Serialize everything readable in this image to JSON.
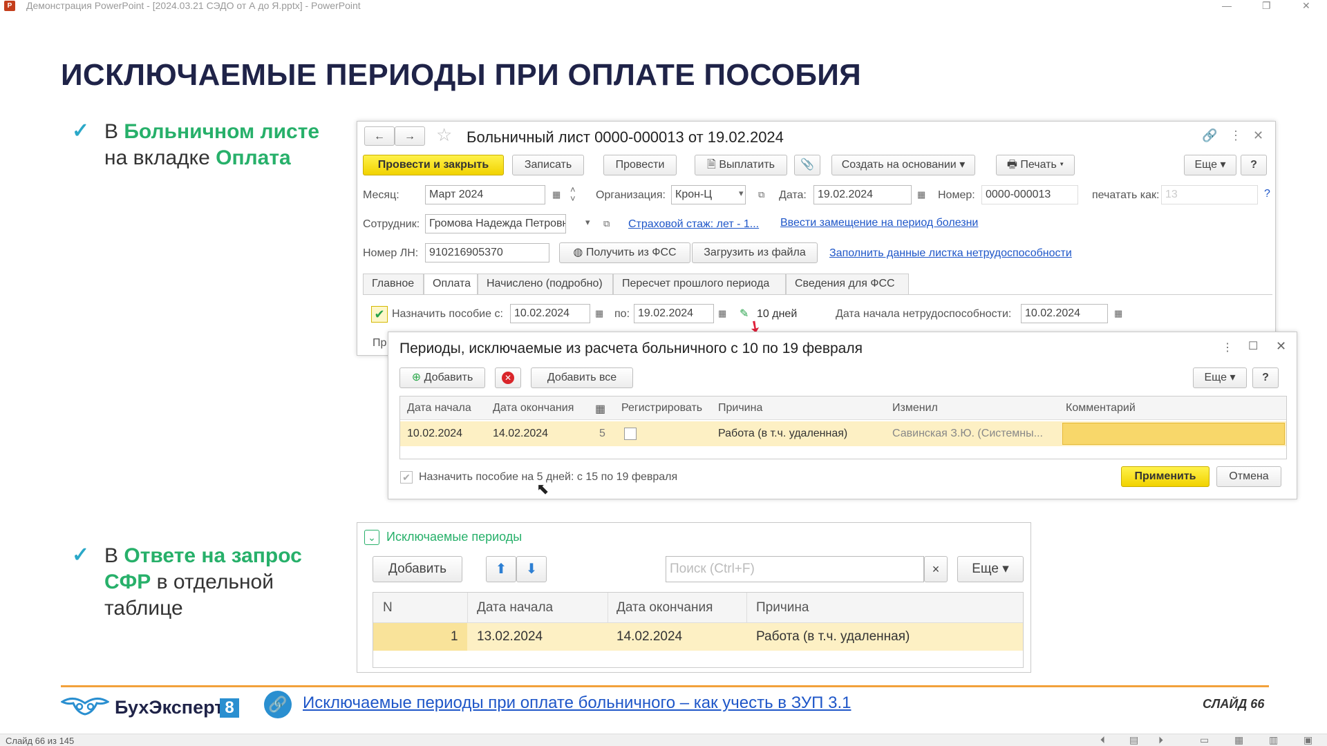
{
  "window": {
    "title": "Демонстрация PowerPoint - [2024.03.21 СЭДО от А до Я.pptx] - PowerPoint",
    "app_icon": "P"
  },
  "slide": {
    "title": "ИСКЛЮЧАЕМЫЕ ПЕРИОДЫ ПРИ ОПЛАТЕ ПОСОБИЯ",
    "bullet1": {
      "prefix": "В ",
      "highlight1": "Больничном листе",
      "middle": "на вкладке ",
      "highlight2": "Оплата"
    },
    "bullet2": {
      "prefix": "В ",
      "highlight1": "Ответе на запрос",
      "highlight2": "СФР",
      "suffix": " в отдельной",
      "line3": "таблице"
    },
    "check_icon": "✓"
  },
  "sick_leave": {
    "title": "Больничный лист 0000-000013 от 19.02.2024",
    "toolbar": {
      "post_close": "Провести и закрыть",
      "save": "Записать",
      "post": "Провести",
      "pay": "Выплатить",
      "create_based": "Создать на основании",
      "print": "Печать",
      "more": "Еще",
      "help": "?"
    },
    "month_label": "Месяц:",
    "month_value": "Март 2024",
    "org_label": "Организация:",
    "org_value": "Крон-Ц",
    "date_label": "Дата:",
    "date_value": "19.02.2024",
    "number_label": "Номер:",
    "number_value": "0000-000013",
    "print_as_label": "печатать как:",
    "print_as_value": "13",
    "employee_label": "Сотрудник:",
    "employee_value": "Громова Надежда Петровна",
    "insurance_link": "Страховой стаж: лет - 1...",
    "replace_link": "Ввести замещение на период болезни",
    "ln_label": "Номер ЛН:",
    "ln_value": "910216905370",
    "get_fss": "Получить из ФСС",
    "load_file": "Загрузить из файла",
    "fill_link": "Заполнить данные листка нетрудоспособности",
    "tabs": [
      "Главное",
      "Оплата",
      "Начислено (подробно)",
      "Пересчет прошлого периода",
      "Сведения для ФСС"
    ],
    "assign_label": "Назначить пособие с:",
    "assign_from": "10.02.2024",
    "assign_to_label": "по:",
    "assign_to": "19.02.2024",
    "days": "10 дней",
    "start_label": "Дата начала нетрудоспособности:",
    "start_value": "10.02.2024",
    "cut_label": "Пр"
  },
  "periods_dialog": {
    "title": "Периоды, исключаемые из расчета больничного с 10 по 19 февраля",
    "add": "Добавить",
    "add_all": "Добавить все",
    "more": "Еще",
    "help": "?",
    "columns": [
      "Дата начала",
      "Дата окончания",
      "",
      "Регистрировать",
      "Причина",
      "Изменил",
      "Комментарий"
    ],
    "rows": [
      {
        "start": "10.02.2024",
        "end": "14.02.2024",
        "days": "5",
        "register": false,
        "reason": "Работа (в т.ч. удаленная)",
        "changed": "Савинская З.Ю. (Системны...",
        "comment": ""
      }
    ],
    "footer_text": "Назначить пособие на 5 дней: с 15 по 19 февраля",
    "apply": "Применить",
    "cancel": "Отмена"
  },
  "sfr_table": {
    "group_title": "Исключаемые периоды",
    "add": "Добавить",
    "search_placeholder": "Поиск (Ctrl+F)",
    "clear": "×",
    "more": "Еще",
    "columns": [
      "N",
      "Дата начала",
      "Дата окончания",
      "Причина"
    ],
    "rows": [
      {
        "n": "1",
        "start": "13.02.2024",
        "end": "14.02.2024",
        "reason": "Работа (в т.ч. удаленная)"
      }
    ]
  },
  "footer": {
    "brand": "БухЭксперт",
    "brand_num": "8",
    "link": "Исключаемые периоды при оплате больничного – как учесть в ЗУП 3.1",
    "slide_label": "СЛАЙД 66"
  },
  "statusbar": {
    "slide_counter": "Слайд 66 из 145"
  },
  "colors": {
    "title": "#1f2348",
    "green": "#27b06a",
    "accent": "#f2a13a",
    "link": "#1e56c8",
    "yellow_button": "#f5dd14",
    "row_highlight": "#fdf0c4"
  }
}
